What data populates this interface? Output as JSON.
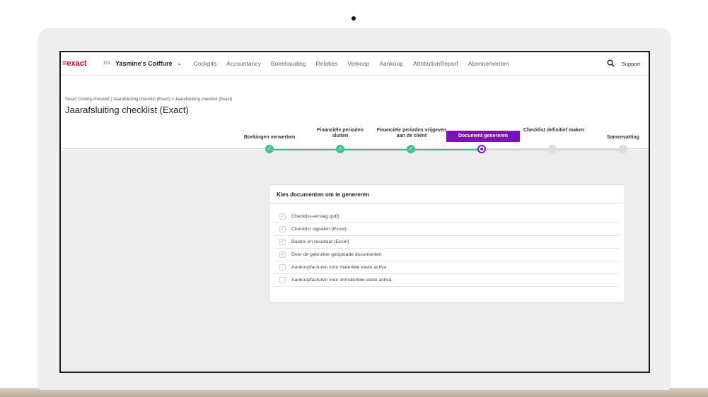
{
  "nav": {
    "logo": "=exact",
    "company_number": "101",
    "company_name": "Yasmine's Coiffure",
    "items": [
      "Cockpits",
      "Accountancy",
      "Boekhouding",
      "Relaties",
      "Verkoop",
      "Aankoop",
      "AttributionReport",
      "Abonnementen"
    ],
    "support": "Support",
    "search_icon": "search-icon"
  },
  "header": {
    "breadcrumb": "Smart Closing-checklist ( Jaarafsluiting checklist (Exact) > Jaarafsluiting checklist (Exact)",
    "title": "Jaarafsluiting checklist (Exact)"
  },
  "stepper": {
    "steps": [
      {
        "label": "Boekingen verwerken",
        "status": "done"
      },
      {
        "label": "Financiële perioden sluiten",
        "status": "done"
      },
      {
        "label": "Financiële perioden vrijgeven aan de cliënt",
        "status": "done"
      },
      {
        "label": "Document genereren",
        "status": "current"
      },
      {
        "label": "Checklist definitief maken",
        "status": "todo"
      },
      {
        "label": "Samenvatting",
        "status": "todo"
      }
    ],
    "accent": "#7a0fc8",
    "done_color": "#3ec28f"
  },
  "card": {
    "title": "Kies documenten om te genereren",
    "items": [
      {
        "label": "Checklist-verslag (pdf)",
        "checked": true
      },
      {
        "label": "Checklist signalen (Excel)",
        "checked": true
      },
      {
        "label": "Balans en resultaat (Excel)",
        "checked": true
      },
      {
        "label": "Door de gebruiker geüploade documenten",
        "checked": true
      },
      {
        "label": "Aankoopfacturen voor materiële vaste activa",
        "checked": false
      },
      {
        "label": "Aankoopfacturen voor immateriële vaste activa",
        "checked": false
      }
    ]
  }
}
